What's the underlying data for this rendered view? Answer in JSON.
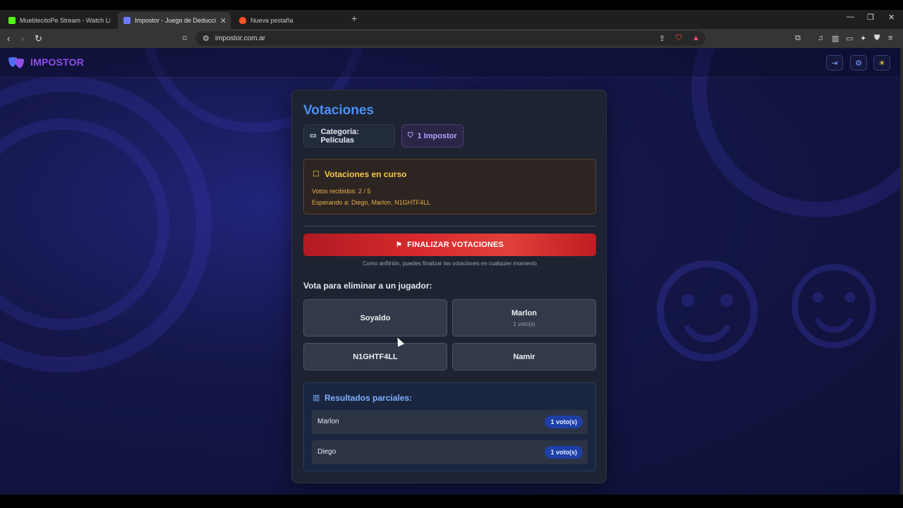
{
  "browser": {
    "tabs": [
      {
        "label": "MueblecitoPe Stream - Watch Live on",
        "favicon_color": "#53fc18"
      },
      {
        "label": "Impostor - Juego de Deducción",
        "favicon_color": "#6c7bff"
      },
      {
        "label": "Nueva pestaña",
        "favicon_color": "#fb542b"
      }
    ],
    "url": "impostor.com.ar"
  },
  "app": {
    "logo_text": "IMPOSTOR"
  },
  "card": {
    "title": "Votaciones",
    "category_chip": "Categoría: Películas",
    "impostor_chip": "1 Impostor",
    "status": {
      "title": "Votaciones en curso",
      "votes_received": "Votos recibidos: 2 / 5",
      "waiting_for": "Esperando a: Diego, Marlon, N1GHTF4LL"
    },
    "finalize_button": "FINALIZAR VOTACIONES",
    "host_hint": "Como anfitrión, puedes finalizar las votaciones en cualquier momento",
    "vote_prompt": "Vota para eliminar a un jugador:",
    "players": [
      {
        "name": "Soyaldo",
        "votes": ""
      },
      {
        "name": "Marlon",
        "votes": "1 voto(s)"
      },
      {
        "name": "N1GHTF4LL",
        "votes": ""
      },
      {
        "name": "Namir",
        "votes": ""
      }
    ],
    "results": {
      "title": "Resultados parciales:",
      "rows": [
        {
          "name": "Marlon",
          "votes": "1 voto(s)"
        },
        {
          "name": "Diego",
          "votes": "1 voto(s)"
        }
      ]
    }
  },
  "colors": {
    "accent_blue": "#4f8ff5",
    "logo_purple": "#8f4fe8",
    "danger_red": "#d82a2e",
    "warning_yellow": "#f5c84a",
    "badge_blue": "#1e3fa8"
  }
}
